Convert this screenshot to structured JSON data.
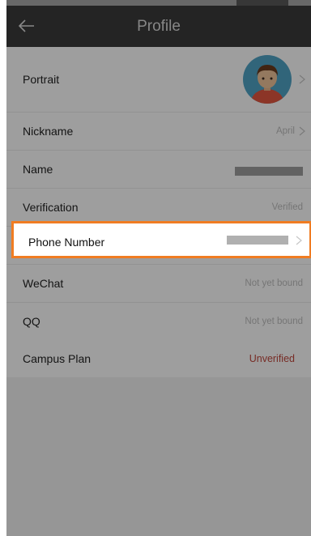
{
  "nav": {
    "title": "Profile",
    "back_icon": "arrow-left-icon"
  },
  "rows": {
    "portrait": {
      "label": "Portrait"
    },
    "nickname": {
      "label": "Nickname",
      "value": "April"
    },
    "name": {
      "label": "Name"
    },
    "verification": {
      "label": "Verification",
      "value": "Verified"
    },
    "phone": {
      "label": "Phone Number"
    },
    "wechat": {
      "label": "WeChat",
      "value": "Not yet bound"
    },
    "qq": {
      "label": "QQ",
      "value": "Not yet bound"
    },
    "campus": {
      "label": "Campus Plan",
      "value": "Unverified"
    }
  },
  "colors": {
    "highlight": "#f07c22",
    "unverified": "#c0473d",
    "navbar": "#3a3a3a"
  }
}
